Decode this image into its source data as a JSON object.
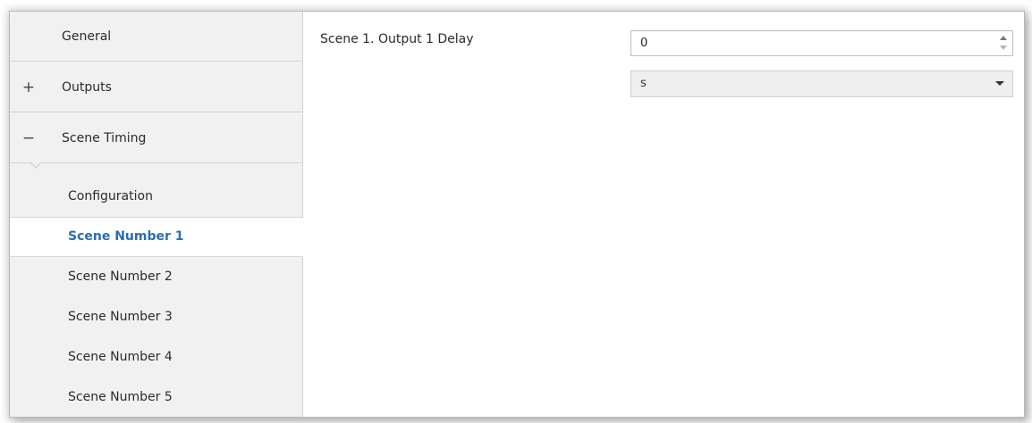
{
  "sidebar": {
    "items": [
      {
        "label": "General",
        "glyph": ""
      },
      {
        "label": "Outputs",
        "glyph": "+",
        "glyph_icon": "plus-icon"
      },
      {
        "label": "Scene Timing",
        "glyph": "−",
        "glyph_icon": "minus-icon"
      }
    ],
    "sub_items": [
      {
        "label": "Configuration"
      },
      {
        "label": "Scene Number 1",
        "selected": true
      },
      {
        "label": "Scene Number 2"
      },
      {
        "label": "Scene Number 3"
      },
      {
        "label": "Scene Number 4"
      },
      {
        "label": "Scene Number 5"
      }
    ],
    "selected_color": "#2d6db0"
  },
  "main": {
    "delay_label": "Scene 1. Output 1 Delay",
    "delay_value": "0",
    "unit_value": "s"
  }
}
